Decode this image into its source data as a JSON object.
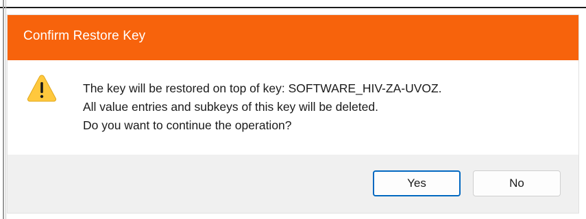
{
  "dialog": {
    "title": "Confirm Restore Key",
    "icon": "warning-icon",
    "message_lines": [
      "The key will be restored on top of key: SOFTWARE_HIV-ZA-UVOZ.",
      "All value entries and subkeys of this key will be deleted.",
      "Do you want to continue the operation?"
    ],
    "buttons": {
      "yes_label": "Yes",
      "no_label": "No"
    }
  },
  "colors": {
    "titlebar": "#f7630c",
    "footer": "#f0f0f0",
    "focus_border": "#0067c0",
    "warning_fill": "#ffc83d"
  }
}
